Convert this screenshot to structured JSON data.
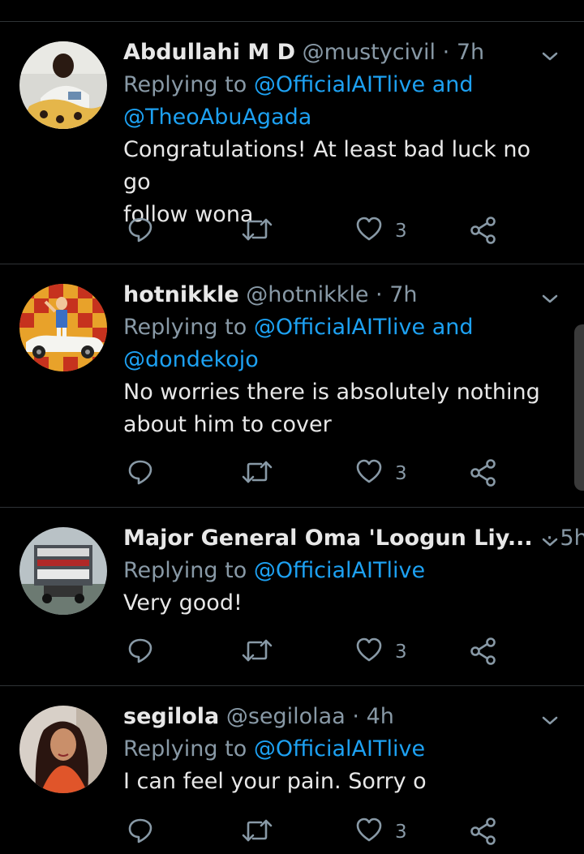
{
  "colors": {
    "background": "#000000",
    "text": "#e8e8e8",
    "muted": "#8899a6",
    "link": "#1da1f2",
    "divider": "#2f3336"
  },
  "tweets": [
    {
      "name": "Abdullahi M D",
      "handle": "@mustycivil",
      "sep": "·",
      "time": "7h",
      "replying_prefix": "Replying to",
      "mention1": "@OfficialAITlive",
      "and_word": "and",
      "mention2": "@TheoAbuAgada",
      "text_line1": "Congratulations! At least bad luck no go",
      "text_line2": "follow wona",
      "like_count": "3",
      "icons": [
        "reply-icon",
        "retweet-icon",
        "like-icon",
        "share-icon"
      ]
    },
    {
      "name": "hotnikkle",
      "handle": "@hotnikkle",
      "sep": "·",
      "time": "7h",
      "replying_prefix": "Replying to",
      "mention1": "@OfficialAITlive",
      "and_word": "and",
      "mention2": "@dondekojo",
      "text_line1": "No worries there is absolutely nothing",
      "text_line2": "about him to cover",
      "like_count": "3",
      "icons": [
        "reply-icon",
        "retweet-icon",
        "like-icon",
        "share-icon"
      ]
    },
    {
      "name": "Major General Oma 'Loogun Liy...",
      "sep": "·",
      "time": "5h",
      "replying_prefix": "Replying to",
      "mention1": "@OfficialAITlive",
      "text_line1": "Very good!",
      "like_count": "3",
      "icons": [
        "reply-icon",
        "retweet-icon",
        "like-icon",
        "share-icon"
      ]
    },
    {
      "name": "segilola",
      "handle": "@segilolaa",
      "sep": "·",
      "time": "4h",
      "replying_prefix": "Replying to",
      "mention1": "@OfficialAITlive",
      "text_line1": "I can feel your pain. Sorry o",
      "like_count": "3",
      "icons": [
        "reply-icon",
        "retweet-icon",
        "like-icon",
        "share-icon"
      ]
    }
  ]
}
